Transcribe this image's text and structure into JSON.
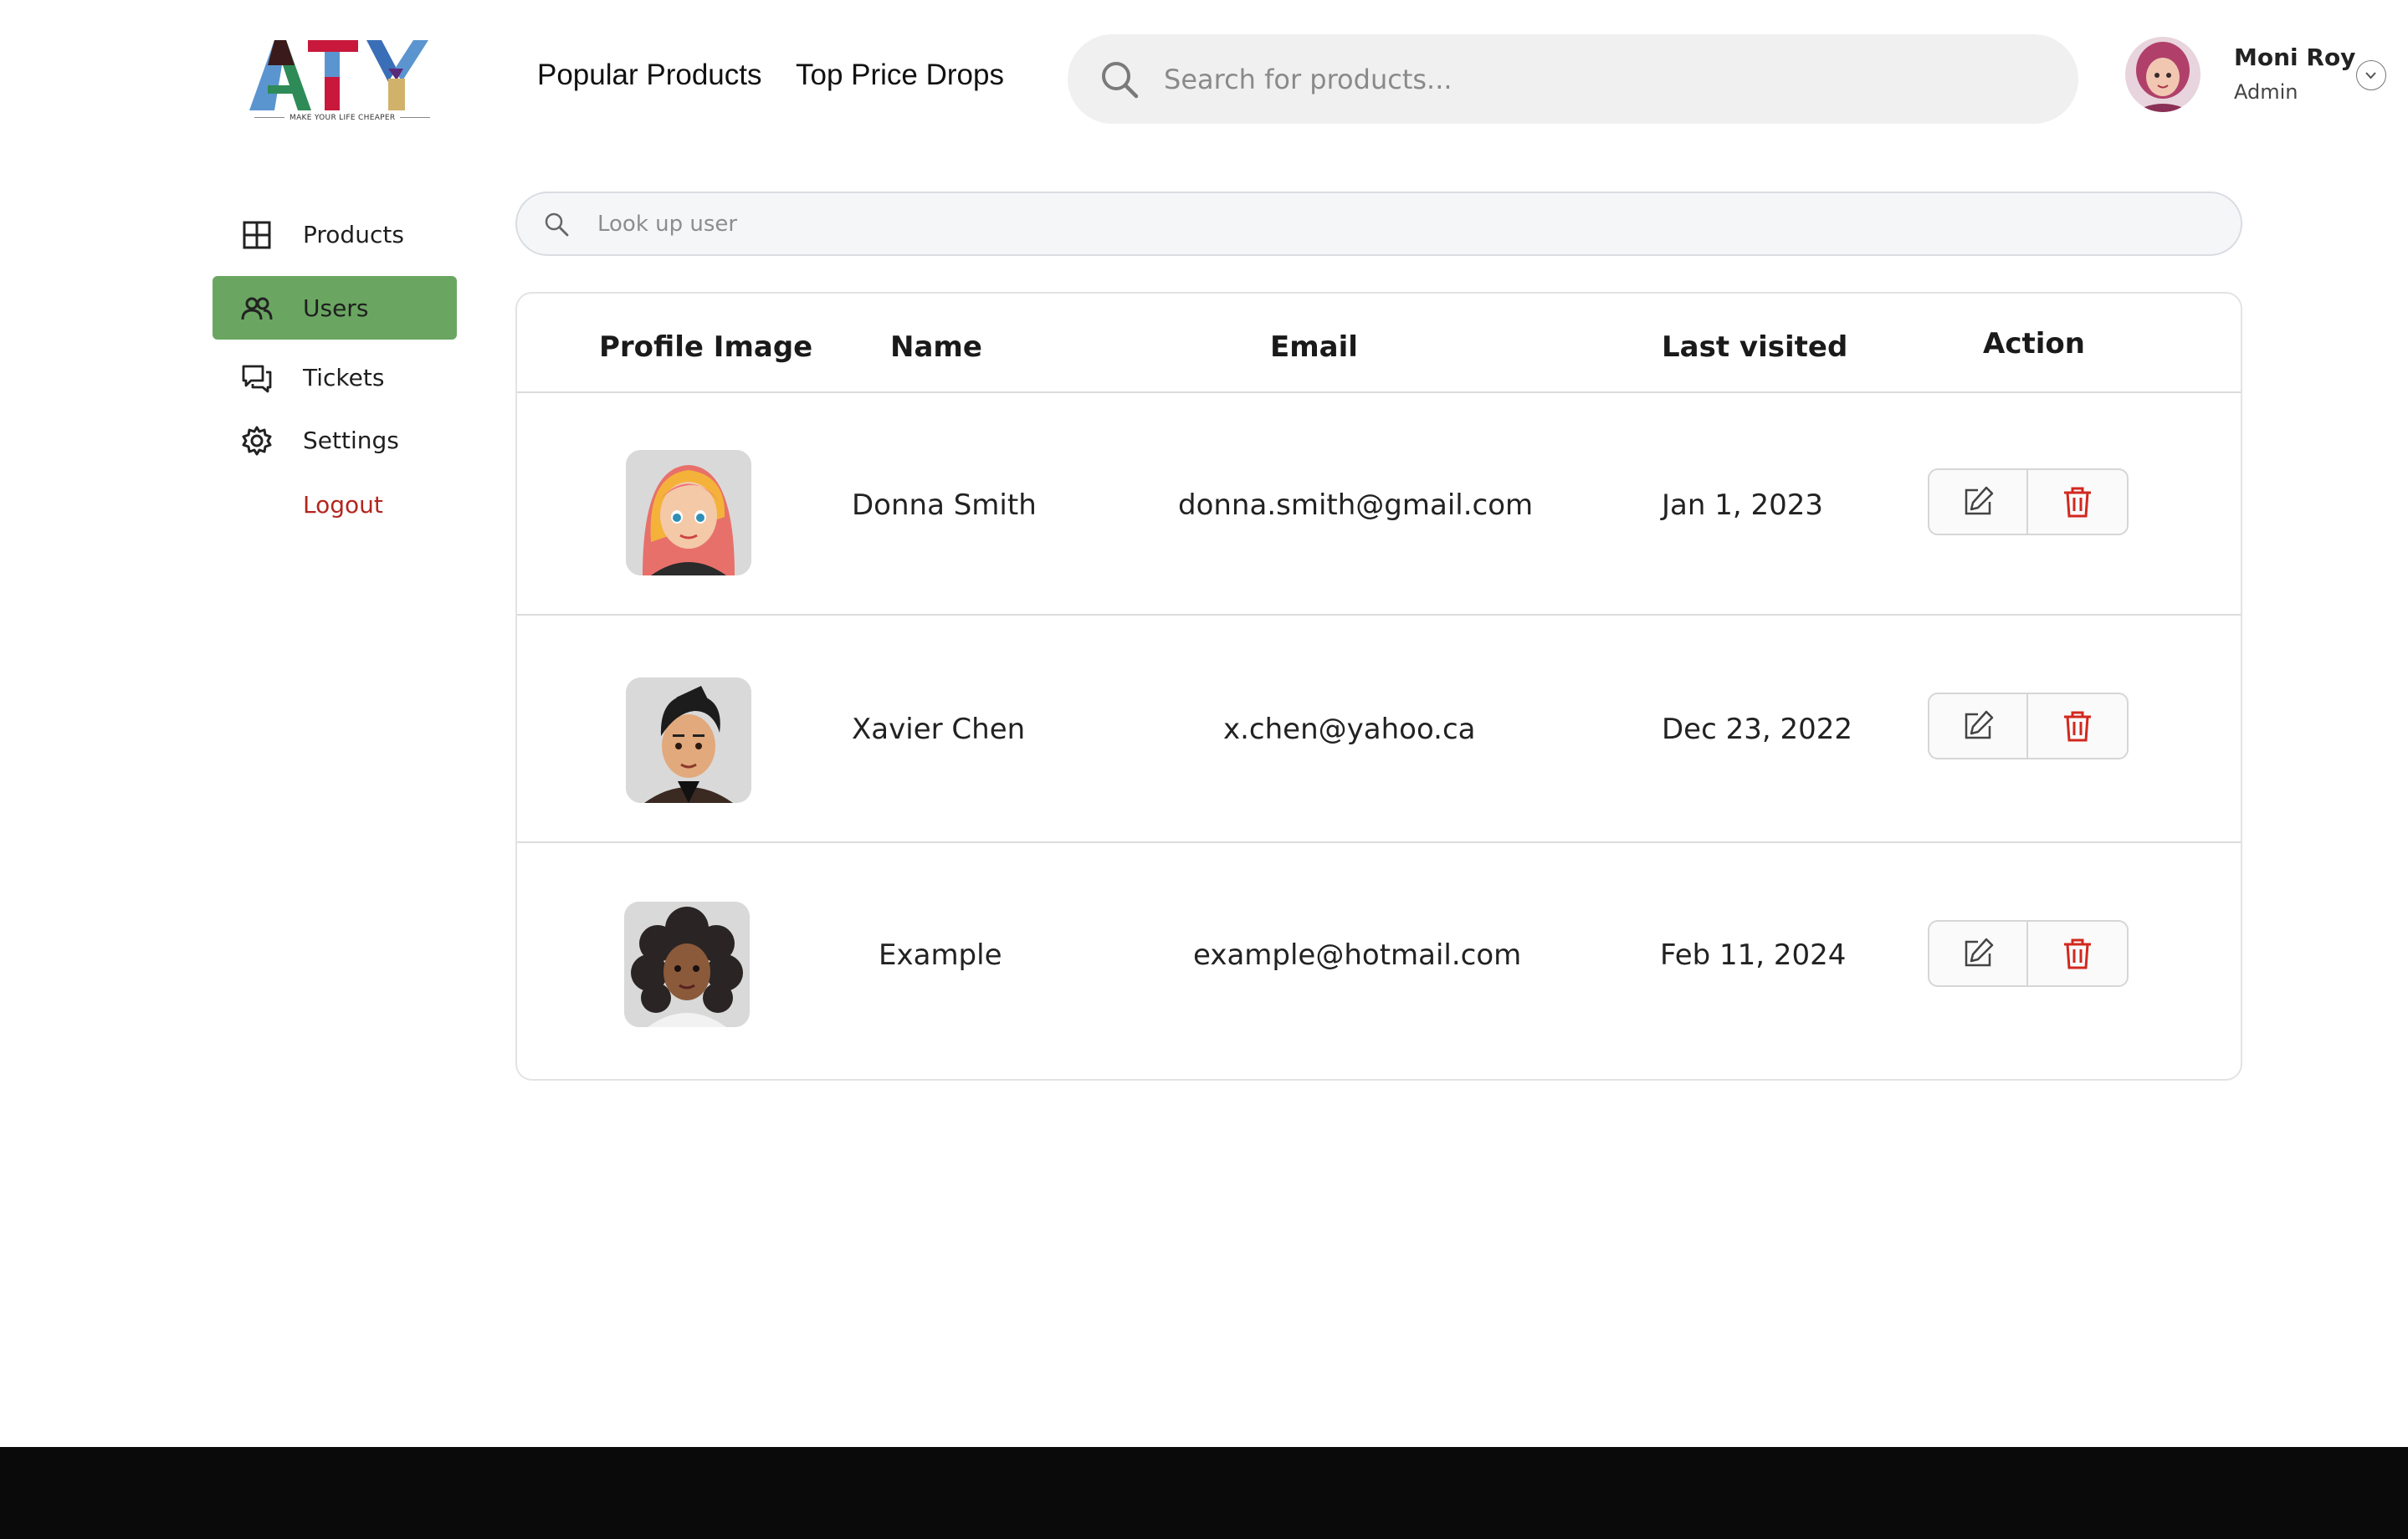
{
  "brand": {
    "name": "ATY",
    "tagline": "MAKE YOUR LIFE CHEAPER"
  },
  "header": {
    "nav": {
      "popular": "Popular Products",
      "drops": "Top Price Drops"
    },
    "search_placeholder": "Search for products...",
    "profile": {
      "name": "Moni Roy",
      "role": "Admin"
    }
  },
  "sidebar": {
    "items": [
      {
        "label": "Products",
        "icon": "grid-icon"
      },
      {
        "label": "Users",
        "icon": "users-icon",
        "active": true
      },
      {
        "label": "Tickets",
        "icon": "chat-icon"
      },
      {
        "label": "Settings",
        "icon": "gear-icon"
      },
      {
        "label": "Logout"
      }
    ],
    "active_color": "#6aa661",
    "logout_color": "#b3261e"
  },
  "user_search": {
    "placeholder": "Look up user"
  },
  "table": {
    "columns": {
      "image": "Profile Image",
      "name": "Name",
      "email": "Email",
      "last": "Last visited",
      "action": "Action"
    },
    "rows": [
      {
        "name": "Donna Smith",
        "email": "donna.smith@gmail.com",
        "last": "Jan 1, 2023"
      },
      {
        "name": "Xavier Chen",
        "email": "x.chen@yahoo.ca",
        "last": "Dec 23, 2022"
      },
      {
        "name": "Example",
        "email": "example@hotmail.com",
        "last": "Feb 11, 2024"
      }
    ]
  }
}
